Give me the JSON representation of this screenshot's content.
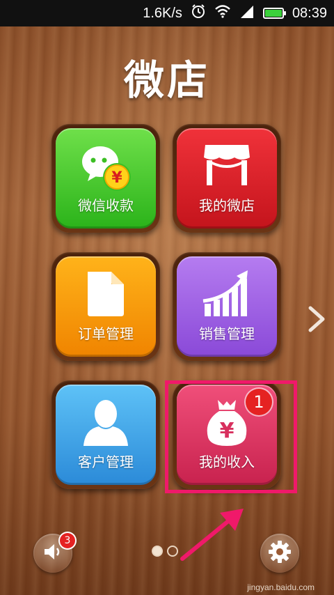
{
  "status_bar": {
    "speed": "1.6K/s",
    "time": "08:39",
    "battery_color": "#3bd13b"
  },
  "app": {
    "title": "微店"
  },
  "tiles": [
    {
      "id": "wechat-pay",
      "label": "微信收款",
      "icon": "chat-yuan-icon"
    },
    {
      "id": "my-store",
      "label": "我的微店",
      "icon": "storefront-icon"
    },
    {
      "id": "orders",
      "label": "订单管理",
      "icon": "document-icon"
    },
    {
      "id": "sales",
      "label": "销售管理",
      "icon": "growth-chart-icon"
    },
    {
      "id": "customers",
      "label": "客户管理",
      "icon": "person-icon"
    },
    {
      "id": "income",
      "label": "我的收入",
      "icon": "money-bag-icon",
      "badge": "1"
    }
  ],
  "currency_symbol": "¥",
  "footer": {
    "sound_badge": "3",
    "watermark": "jingyan.baidu.com"
  },
  "pager": {
    "current": 1,
    "total": 2
  },
  "colors": {
    "highlight": "#f0196a",
    "badge": "#e52222"
  }
}
